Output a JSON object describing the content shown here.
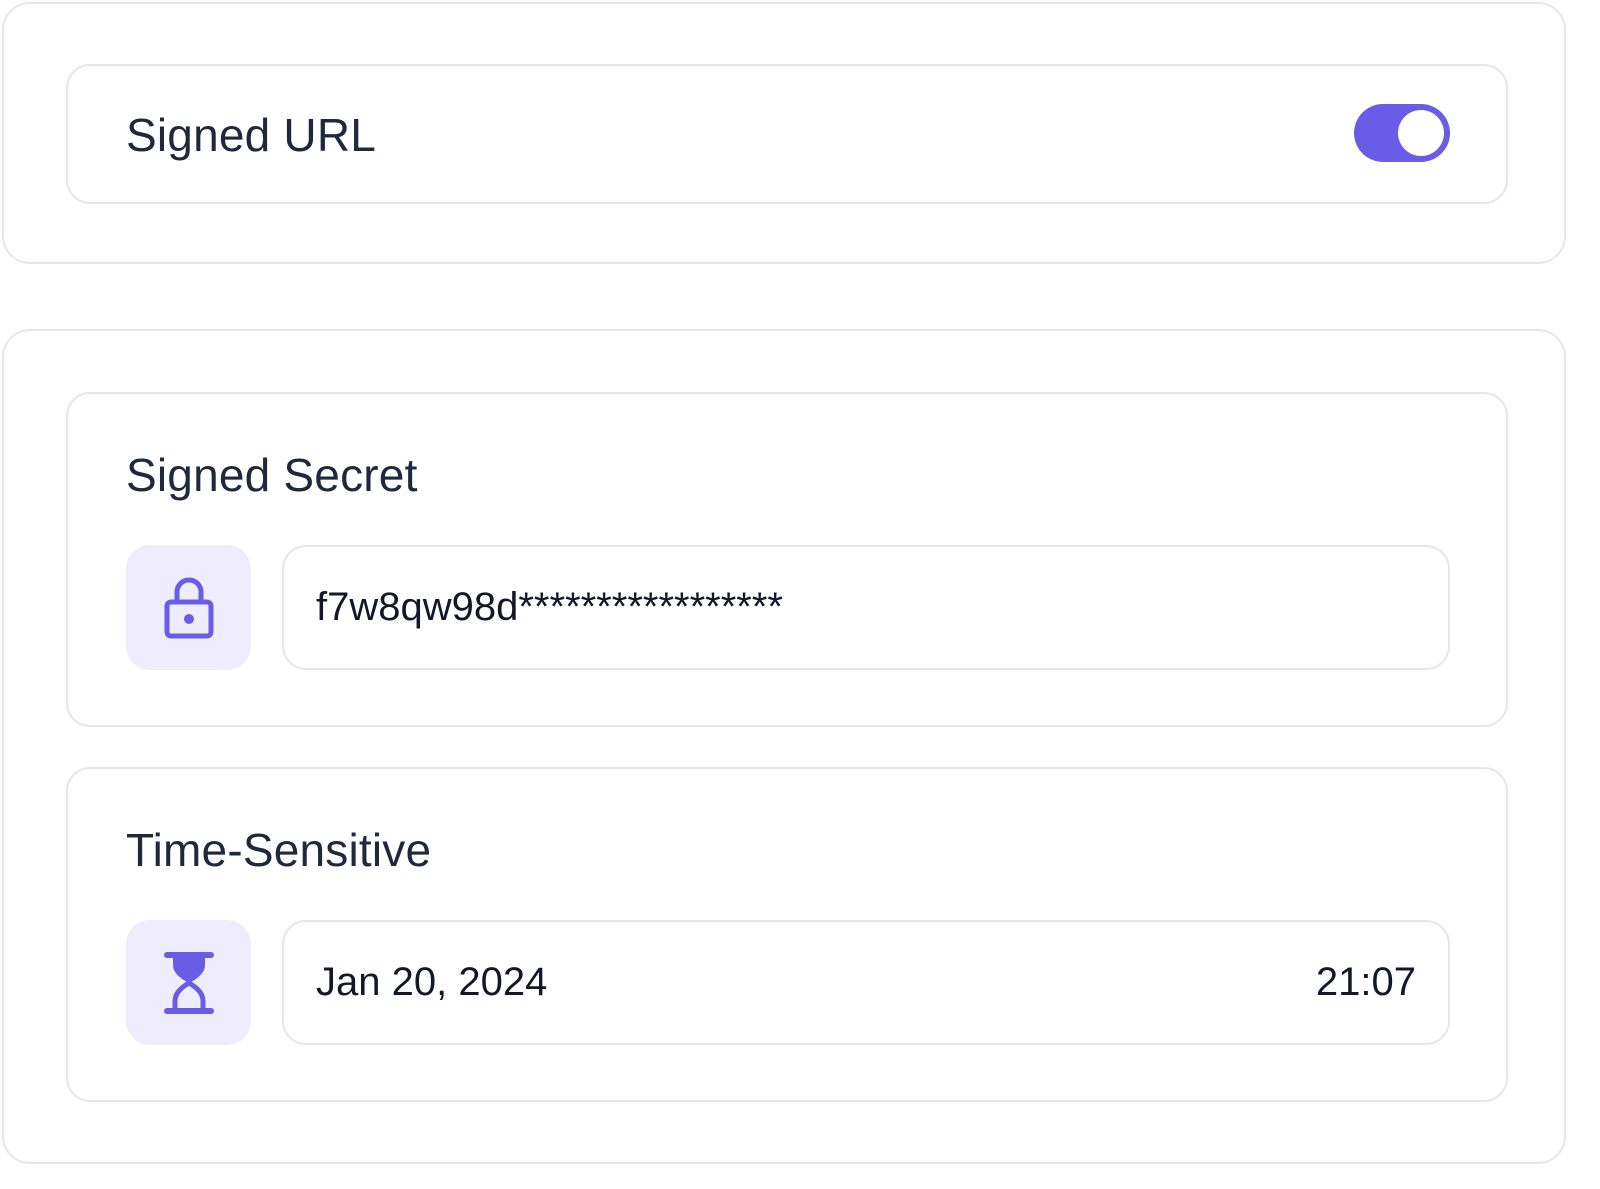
{
  "signed_url": {
    "label": "Signed URL",
    "enabled": true
  },
  "signed_secret": {
    "label": "Signed Secret",
    "icon": "lock-icon",
    "value": "f7w8qw98d*****************"
  },
  "time_sensitive": {
    "label": "Time-Sensitive",
    "icon": "hourglass-icon",
    "date": "Jan 20, 2024",
    "time": "21:07"
  },
  "colors": {
    "accent": "#6b5ce7",
    "icon_background": "#efecfd",
    "border": "#e5e7eb"
  }
}
